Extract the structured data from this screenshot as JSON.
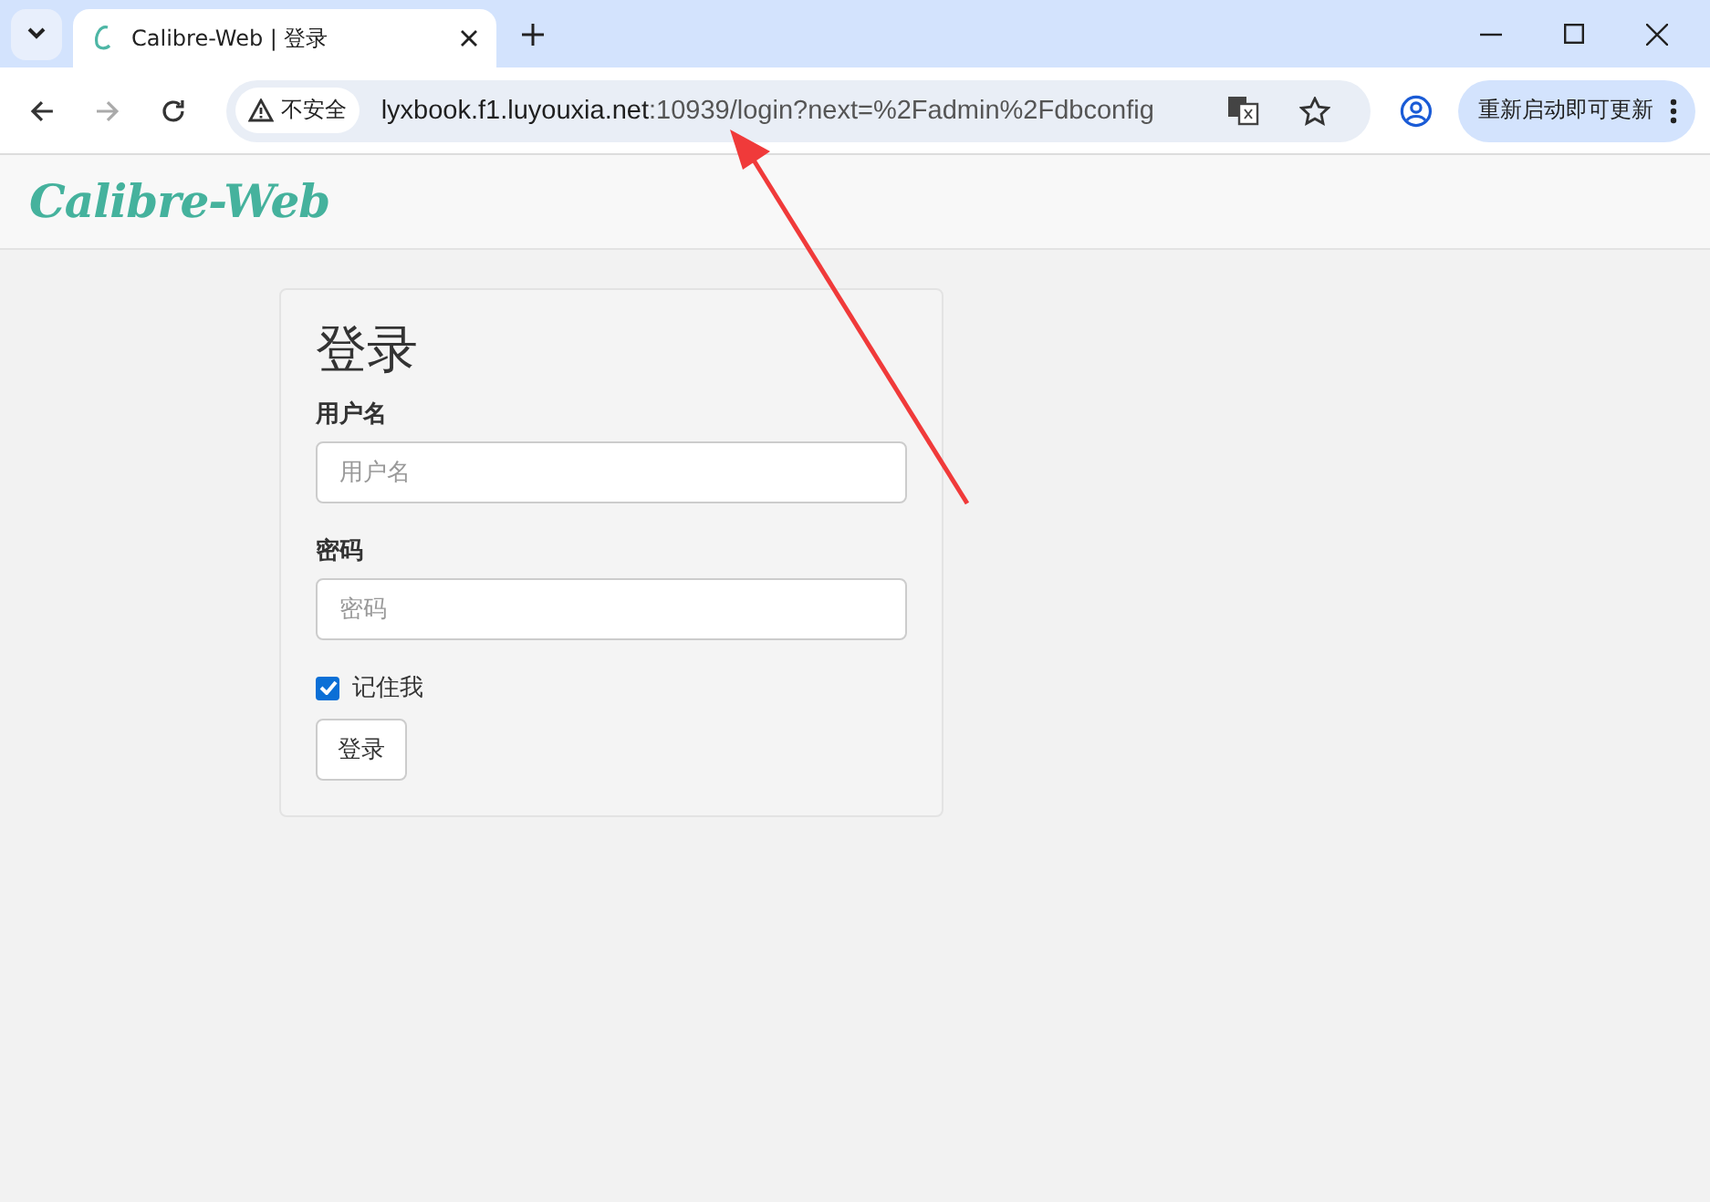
{
  "browser": {
    "tab": {
      "title": "Calibre-Web | 登录",
      "selected": true
    },
    "security": "不安全",
    "url": {
      "host": "lyxbook.f1.luyouxia.net",
      "rest": ":10939/login?next=%2Fadmin%2Fdbconfig"
    },
    "update_button": "重新启动即可更新"
  },
  "navbar": {
    "brand": "Calibre-Web"
  },
  "login": {
    "heading": "登录",
    "fields": [
      {
        "label": "用户名",
        "placeholder": "用户名"
      },
      {
        "label": "密码",
        "placeholder": "密码"
      }
    ],
    "remember": {
      "label": "记住我",
      "checked": true
    },
    "submit": "登录"
  },
  "annotation": {
    "kind": "arrow"
  }
}
